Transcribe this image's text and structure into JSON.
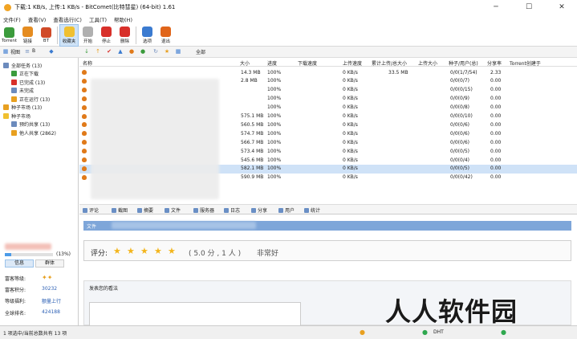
{
  "window": {
    "title": "下载:1 KB/s, 上传:1 KB/s - BitComet(比特彗星) (64-bit) 1.61",
    "minimize": "─",
    "maximize": "☐",
    "close": "✕"
  },
  "menu": [
    "文件(F)",
    "查看(V)",
    "查看选行(C)",
    "工具(T)",
    "帮助(H)"
  ],
  "toolbar": [
    {
      "label": "Torrent",
      "color": "#3b9b3c"
    },
    {
      "label": "链接",
      "color": "#e58c20"
    },
    {
      "label": "BT",
      "color": "#d04a28"
    },
    {
      "label": "收藏夹",
      "color": "#f0c030"
    },
    {
      "label": "开始",
      "color": "#b0b0b0"
    },
    {
      "label": "停止",
      "color": "#d8302a"
    },
    {
      "label": "删除",
      "color": "#d8302a"
    },
    {
      "label": "选项",
      "color": "#3b7bd0"
    },
    {
      "label": "退出",
      "color": "#e0651a"
    }
  ],
  "subtoolbar": {
    "tabs": [
      "视图",
      "B"
    ],
    "filter_label": "全部"
  },
  "sidebar": {
    "items": [
      {
        "label": "全部任务 (13)",
        "indent": 0,
        "color": "#6c8bbd"
      },
      {
        "label": "正在下载",
        "indent": 1,
        "color": "#3b9b3c"
      },
      {
        "label": "已完成 (13)",
        "indent": 1,
        "color": "#d8302a"
      },
      {
        "label": "未完成",
        "indent": 1,
        "color": "#6c8bbd"
      },
      {
        "label": "正在运行 (13)",
        "indent": 1,
        "color": "#e8a020"
      },
      {
        "label": "种子市场 (13)",
        "indent": 0,
        "color": "#e8a020"
      },
      {
        "label": "种子市场",
        "indent": 0,
        "color": "#f0c030"
      },
      {
        "label": "预约共享 (13)",
        "indent": 1,
        "color": "#6c8bbd"
      },
      {
        "label": "他人共享 (2862)",
        "indent": 1,
        "color": "#e8a020"
      }
    ]
  },
  "account": {
    "progress_label": "(13%)",
    "login_tabs": [
      "信息",
      "群体"
    ],
    "fields": [
      {
        "label": "富客等级:",
        "value": ""
      },
      {
        "label": "富客积分:",
        "value": "30232"
      },
      {
        "label": "等级福利:",
        "value": "额量上行"
      },
      {
        "label": "全球排名:",
        "value": "424188"
      }
    ]
  },
  "columns": [
    "名称",
    "大小",
    "进度",
    "下载速度",
    "上传速度",
    "累计上传/总大小",
    "上传大小",
    "种子/用户(总)",
    "分享率",
    "Torrent创建于"
  ],
  "rows": [
    {
      "size": "14.3 MB",
      "progress": "100%",
      "dl": "",
      "ul": "0 KB/s",
      "uploaded": "33.5 MB",
      "up_size": "",
      "peers": "0/0(1/7/54)",
      "ratio": "2.33",
      "name": "",
      "selected": false
    },
    {
      "size": "2.8 MB",
      "progress": "100%",
      "dl": "",
      "ul": "0 KB/s",
      "uploaded": "",
      "up_size": "",
      "peers": "0/0(0/7)",
      "ratio": "0.00",
      "name": "",
      "selected": false
    },
    {
      "size": "",
      "progress": "100%",
      "dl": "",
      "ul": "0 KB/s",
      "uploaded": "",
      "up_size": "",
      "peers": "0/0(0/15)",
      "ratio": "0.00",
      "name": "",
      "selected": false
    },
    {
      "size": "",
      "progress": "100%",
      "dl": "",
      "ul": "0 KB/s",
      "uploaded": "",
      "up_size": "",
      "peers": "0/0(0/9)",
      "ratio": "0.00",
      "name": "",
      "selected": false
    },
    {
      "size": "",
      "progress": "100%",
      "dl": "",
      "ul": "0 KB/s",
      "uploaded": "",
      "up_size": "",
      "peers": "0/0(0/8)",
      "ratio": "0.00",
      "name": "",
      "selected": false
    },
    {
      "size": "575.1 MB",
      "progress": "100%",
      "dl": "",
      "ul": "0 KB/s",
      "uploaded": "",
      "up_size": "",
      "peers": "0/0(0/10)",
      "ratio": "0.00",
      "name": "",
      "selected": false
    },
    {
      "size": "560.5 MB",
      "progress": "100%",
      "dl": "",
      "ul": "0 KB/s",
      "uploaded": "",
      "up_size": "",
      "peers": "0/0(0/6)",
      "ratio": "0.00",
      "name": "",
      "selected": false
    },
    {
      "size": "574.7 MB",
      "progress": "100%",
      "dl": "",
      "ul": "0 KB/s",
      "uploaded": "",
      "up_size": "",
      "peers": "0/0(0/6)",
      "ratio": "0.00",
      "name": "",
      "selected": false
    },
    {
      "size": "566.7 MB",
      "progress": "100%",
      "dl": "",
      "ul": "0 KB/s",
      "uploaded": "",
      "up_size": "",
      "peers": "0/0(0/6)",
      "ratio": "0.00",
      "name": "",
      "selected": false
    },
    {
      "size": "573.4 MB",
      "progress": "100%",
      "dl": "",
      "ul": "0 KB/s",
      "uploaded": "",
      "up_size": "",
      "peers": "0/0(0/5)",
      "ratio": "0.00",
      "name": "",
      "selected": false
    },
    {
      "size": "545.6 MB",
      "progress": "100%",
      "dl": "",
      "ul": "0 KB/s",
      "uploaded": "",
      "up_size": "",
      "peers": "0/0(0/4)",
      "ratio": "0.00",
      "name": "",
      "selected": false
    },
    {
      "size": "582.1 MB",
      "progress": "100%",
      "dl": "",
      "ul": "0 KB/s",
      "uploaded": "",
      "up_size": "",
      "peers": "0/0(0/5)",
      "ratio": "0.00",
      "name": "",
      "selected": true
    },
    {
      "size": "590.9 MB",
      "progress": "100%",
      "dl": "",
      "ul": "0 KB/s",
      "uploaded": "",
      "up_size": "",
      "peers": "0/0(0/42)",
      "ratio": "0.00",
      "name": "",
      "selected": false
    }
  ],
  "detail_tabs": [
    "评论",
    "截图",
    "摘要",
    "文件",
    "服务器",
    "日志",
    "分享",
    "用户",
    "统计"
  ],
  "detail": {
    "file_bar": "文件",
    "rating_label": "评分:",
    "stars": 5,
    "score_text": "( 5.0 分 , 1 人 )",
    "verdict": "非常好",
    "comment_title": "发表您的看法"
  },
  "status": {
    "left": "1 项选中/当前总数共有 13 项",
    "dht": "DHT",
    "watermark": "人人软件园"
  }
}
